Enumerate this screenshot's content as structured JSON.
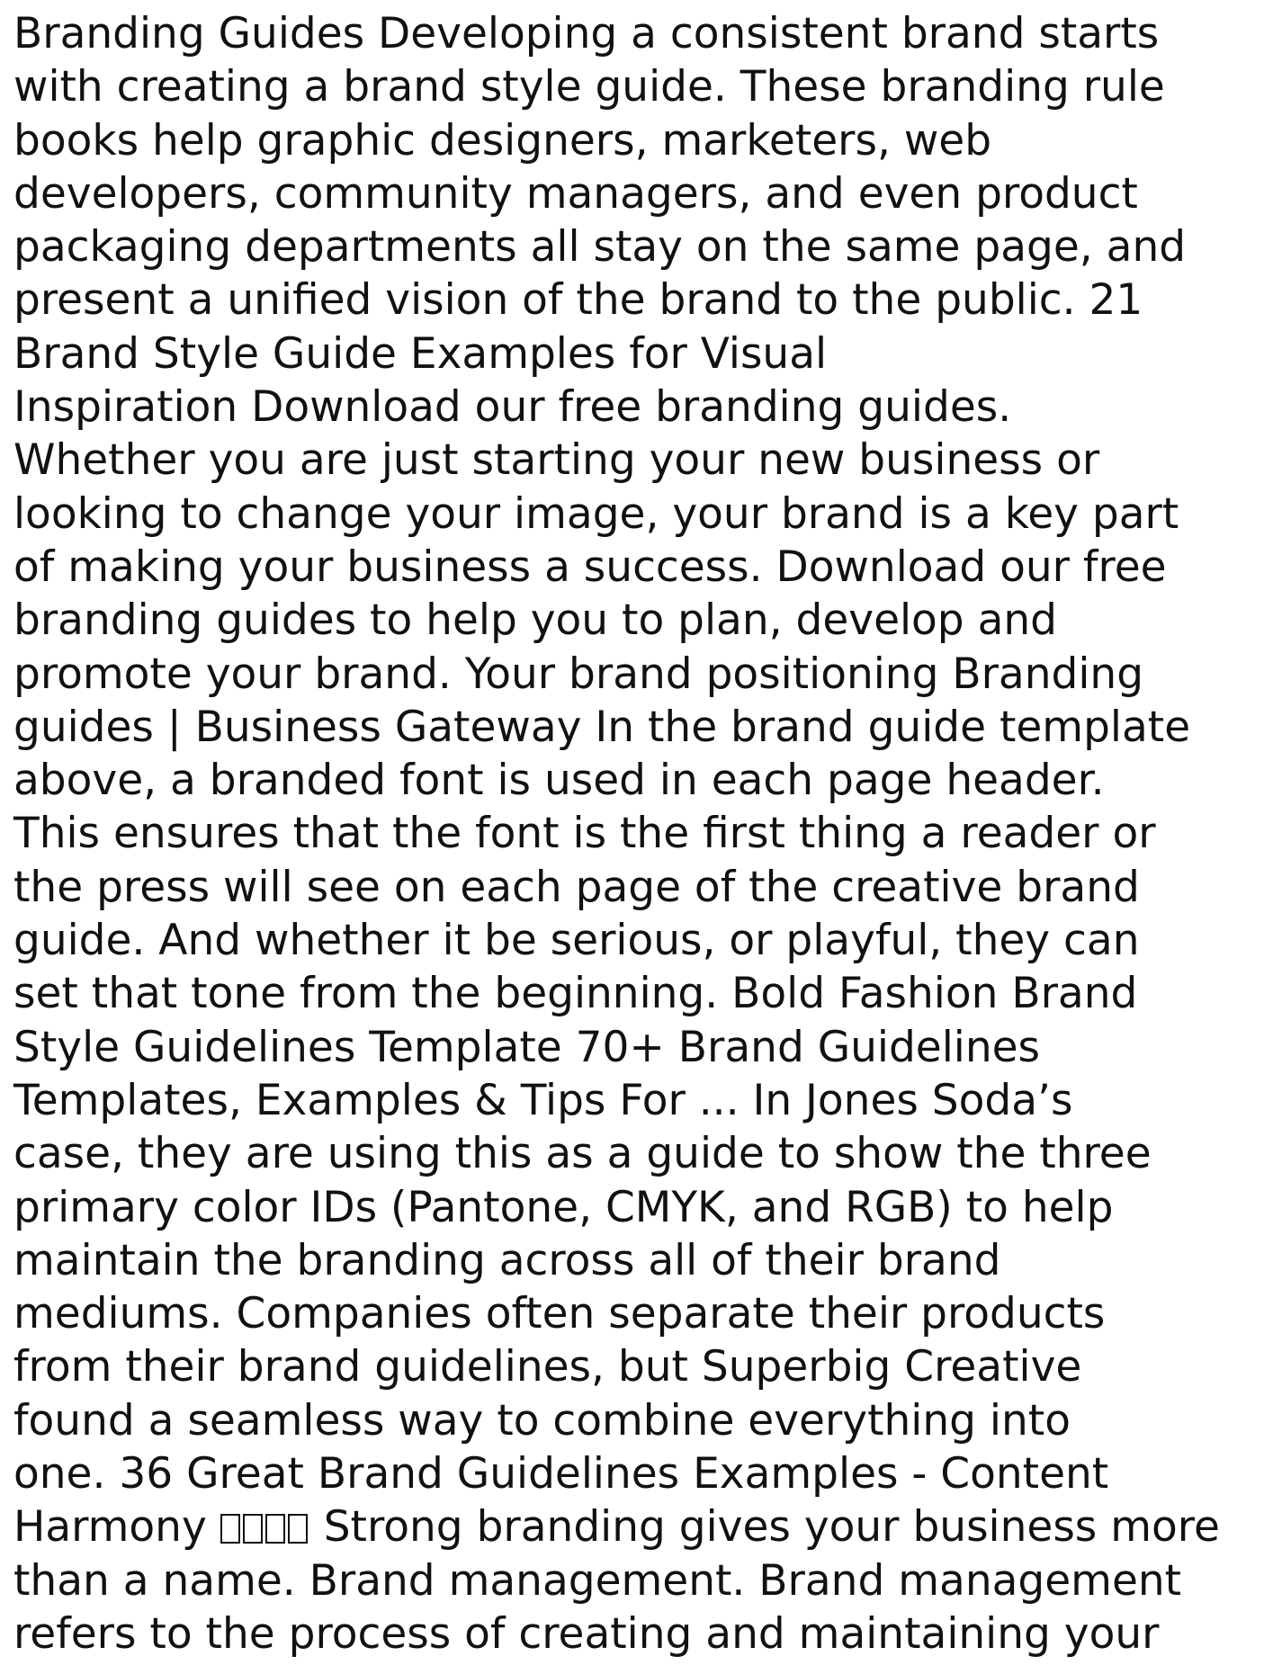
{
  "document": {
    "lines": [
      "Branding Guides Developing a consistent brand starts",
      "with creating a brand style guide. These branding rule",
      "books help graphic designers, marketers, web",
      "developers, community managers, and even product",
      "packaging departments all stay on the same page, and",
      "present a unified vision of the brand to the public. 21",
      "Brand Style Guide Examples for Visual",
      "Inspiration Download our free branding guides.",
      "Whether you are just starting your new business or",
      "looking to change your image, your brand is a key part",
      "of making your business a success. Download our free",
      "branding guides to help you to plan, develop and",
      "promote your brand. Your brand positioning Branding",
      "guides | Business Gateway In the brand guide template",
      "above, a branded font is used in each page header.",
      "This ensures that the font is the first thing a reader or",
      "the press will see on each page of the creative brand",
      "guide. And whether it be serious, or playful, they can",
      "set that tone from the beginning. Bold Fashion Brand",
      "Style Guidelines Template 70+ Brand Guidelines",
      "Templates, Examples & Tips For ... In Jones Soda’s",
      "case, they are using this as a guide to show the three",
      "primary color IDs (Pantone, CMYK, and RGB) to help",
      "maintain the branding across all of their brand",
      "mediums. Companies often separate their products",
      "from their brand guidelines, but Superbig Creative",
      "found a seamless way to combine everything into",
      "one. 36 Great Brand Guidelines Examples - Content"
    ],
    "harmony_prefix": "Harmony",
    "harmony_suffix": "Strong branding gives your business more",
    "lines_after": [
      "than a name. Brand management. Brand management",
      "refers to the process of creating and maintaining your"
    ]
  }
}
